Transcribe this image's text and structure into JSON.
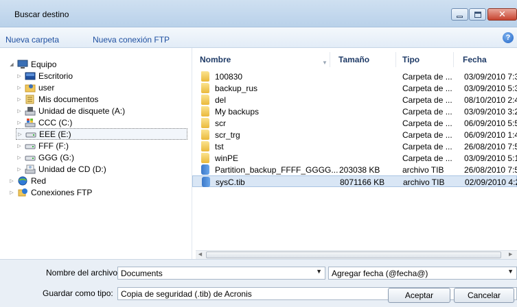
{
  "window": {
    "title": "Buscar destino"
  },
  "toolbar": {
    "new_folder": "Nueva carpeta",
    "new_ftp": "Nueva conexión FTP"
  },
  "tree": {
    "items": [
      {
        "label": "Equipo",
        "icon": "computer-icon"
      },
      {
        "label": "Escritorio",
        "icon": "desktop-icon"
      },
      {
        "label": "user",
        "icon": "user-folder-icon"
      },
      {
        "label": "Mis documentos",
        "icon": "documents-icon"
      },
      {
        "label": "Unidad de disquete (A:)",
        "icon": "floppy-drive-icon"
      },
      {
        "label": "CCC (C:)",
        "icon": "system-drive-icon"
      },
      {
        "label": "EEE (E:)",
        "icon": "drive-icon"
      },
      {
        "label": "FFF (F:)",
        "icon": "drive-icon"
      },
      {
        "label": "GGG (G:)",
        "icon": "drive-icon"
      },
      {
        "label": "Unidad de CD (D:)",
        "icon": "cd-drive-icon"
      },
      {
        "label": "Red",
        "icon": "network-icon"
      },
      {
        "label": "Conexiones FTP",
        "icon": "ftp-icon"
      }
    ]
  },
  "list": {
    "columns": [
      "Nombre",
      "Tamaño",
      "Tipo",
      "Fecha"
    ],
    "rows": [
      {
        "name": "100830",
        "size": "",
        "type": "Carpeta de ...",
        "date": "03/09/2010 7:3",
        "icon": "folder-icon"
      },
      {
        "name": "backup_rus",
        "size": "",
        "type": "Carpeta de ...",
        "date": "03/09/2010 5:3",
        "icon": "folder-icon"
      },
      {
        "name": "del",
        "size": "",
        "type": "Carpeta de ...",
        "date": "08/10/2010 2:4",
        "icon": "folder-icon"
      },
      {
        "name": "My backups",
        "size": "",
        "type": "Carpeta de ...",
        "date": "03/09/2010 3:2",
        "icon": "folder-icon"
      },
      {
        "name": "scr",
        "size": "",
        "type": "Carpeta de ...",
        "date": "06/09/2010 5:5",
        "icon": "folder-icon"
      },
      {
        "name": "scr_trg",
        "size": "",
        "type": "Carpeta de ...",
        "date": "06/09/2010 1:4",
        "icon": "folder-icon"
      },
      {
        "name": "tst",
        "size": "",
        "type": "Carpeta de ...",
        "date": "26/08/2010 7:5",
        "icon": "folder-icon"
      },
      {
        "name": "winPE",
        "size": "",
        "type": "Carpeta de ...",
        "date": "03/09/2010 5:1",
        "icon": "folder-icon"
      },
      {
        "name": "Partition_backup_FFFF_GGGG...",
        "size": "203038 KB",
        "type": "archivo TIB",
        "date": "26/08/2010 7:5",
        "icon": "tib-file-icon"
      },
      {
        "name": "sysC.tib",
        "size": "8071166 KB",
        "type": "archivo TIB",
        "date": "02/09/2010 4:2",
        "icon": "tib-file-icon"
      }
    ]
  },
  "form": {
    "filename_label": "Nombre del archivo:",
    "filename_value": "Documents",
    "date_option": "Agregar fecha (@fecha@)",
    "type_label": "Guardar como tipo:",
    "type_value": "Copia de seguridad (.tib) de Acronis"
  },
  "buttons": {
    "ok": "Aceptar",
    "cancel": "Cancelar"
  },
  "colors": {
    "link": "#1e4fa0",
    "header": "#1e3a66",
    "selected_row": "#d9e6f5"
  }
}
